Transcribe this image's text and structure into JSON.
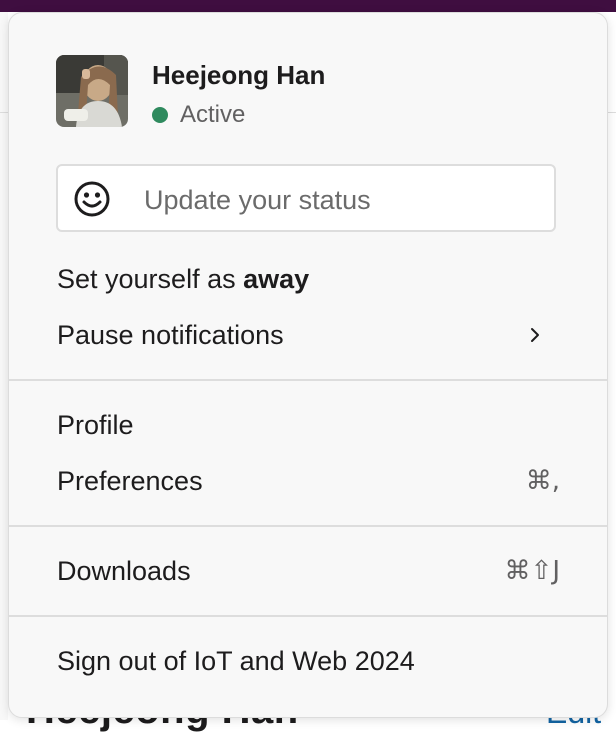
{
  "background": {
    "name_text": "Heejeong Han",
    "edit_text": "Edit"
  },
  "user": {
    "name": "Heejeong Han",
    "presence": "Active",
    "presence_color": "#2f8a5e",
    "avatar": "profile-photo"
  },
  "status": {
    "placeholder": "Update your status",
    "icon": "smiley-icon"
  },
  "menu": {
    "away_prefix": "Set yourself as ",
    "away_bold": "away",
    "pause": "Pause notifications",
    "profile": "Profile",
    "preferences": "Preferences",
    "preferences_shortcut": "⌘,",
    "downloads": "Downloads",
    "downloads_shortcut": "⌘⇧J",
    "sign_out": "Sign out of IoT and Web 2024"
  },
  "colors": {
    "workspace_bar": "#3f0e40",
    "link": "#1264a3"
  }
}
